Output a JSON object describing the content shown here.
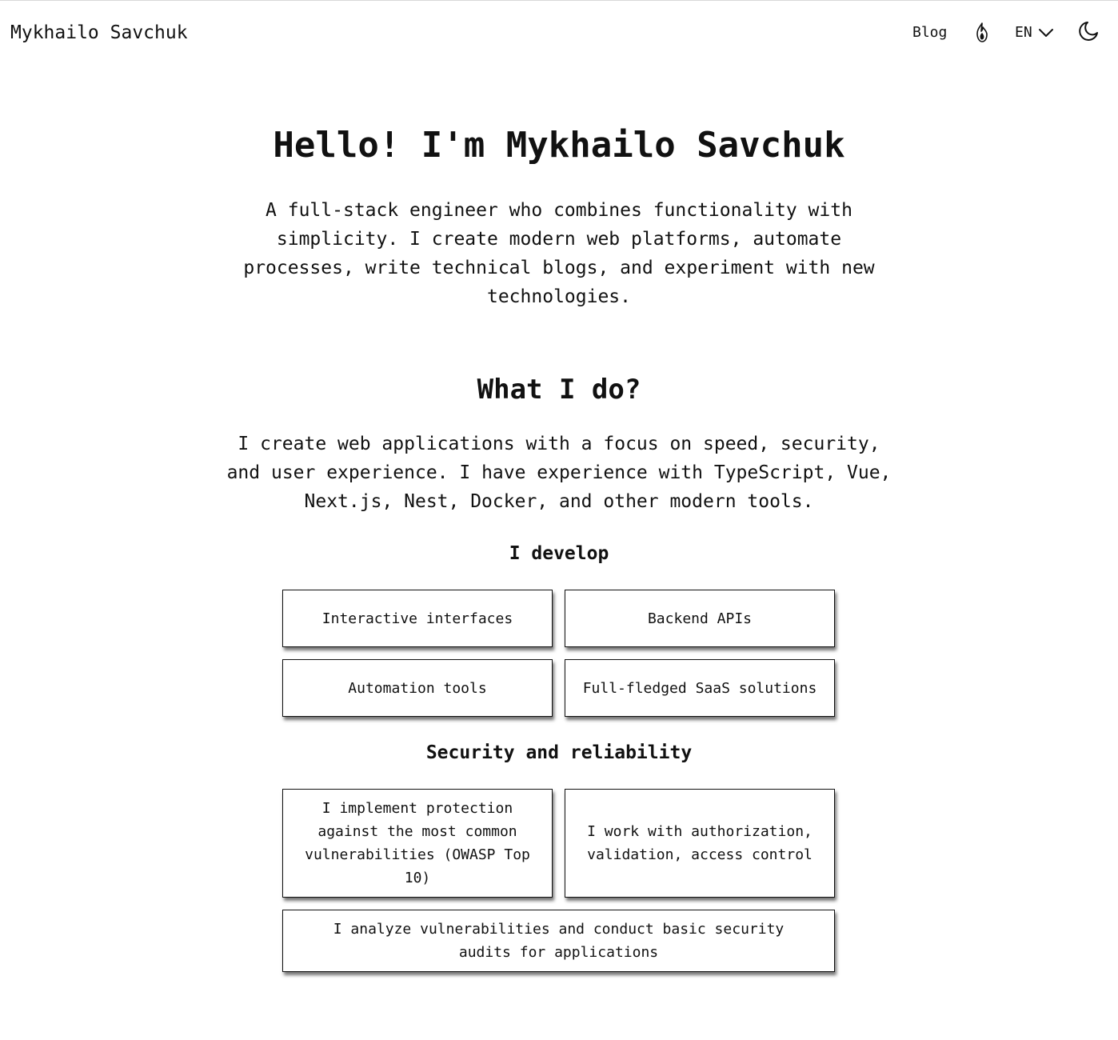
{
  "header": {
    "site_name": "Mykhailo Savchuk",
    "nav": {
      "blog_label": "Blog",
      "tor_icon": "flame-icon",
      "language_label": "EN",
      "language_icon": "chevron-down-icon",
      "theme_icon": "moon-icon"
    }
  },
  "hero": {
    "title": "Hello! I'm Mykhailo Savchuk",
    "text": "A full-stack engineer who combines functionality with simplicity. I create modern web platforms, automate processes, write technical blogs, and experiment with new technologies."
  },
  "what_i_do": {
    "title": "What I do?",
    "text": "I create web applications with a focus on speed, security, and user experience. I have experience with TypeScript, Vue, Next.js, Nest, Docker, and other modern tools."
  },
  "develop": {
    "title": "I develop",
    "items": [
      "Interactive interfaces",
      "Backend APIs",
      "Automation tools",
      "Full-fledged SaaS solutions"
    ]
  },
  "security": {
    "title": "Security and reliability",
    "items": [
      "I implement protection against the most common vulnerabilities (OWASP Top 10)",
      "I work with authorization, validation, access control",
      "I analyze vulnerabilities and conduct basic security audits for applications"
    ]
  },
  "colors": {
    "text": "#111111",
    "background": "#ffffff",
    "border": "#111111"
  }
}
